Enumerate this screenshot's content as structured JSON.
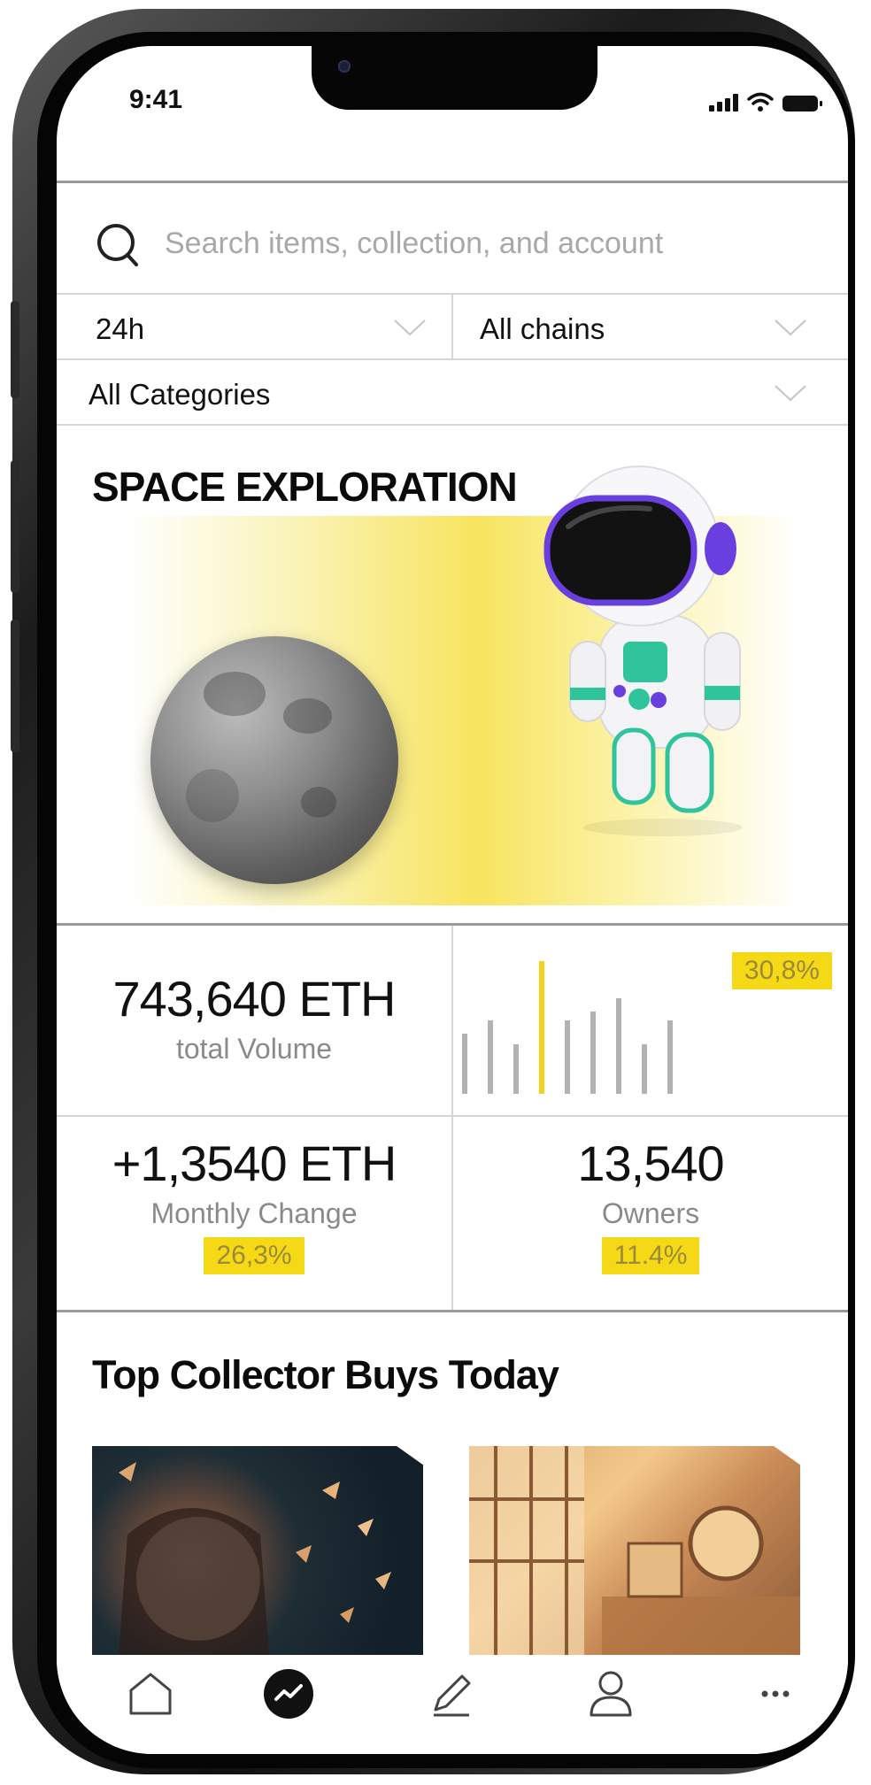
{
  "status_bar": {
    "time": "9:41"
  },
  "search": {
    "placeholder": "Search items, collection, and account"
  },
  "filters": {
    "time_range": "24h",
    "chain": "All chains",
    "category": "All Categories"
  },
  "hero": {
    "title": "SPACE EXPLORATION"
  },
  "stats": {
    "total_volume": {
      "value": "743,640 ETH",
      "label": "total Volume"
    },
    "volume_change": {
      "badge": "30,8%"
    },
    "monthly_change": {
      "value": "+1,3540 ETH",
      "label": "Monthly Change",
      "badge": "26,3%"
    },
    "owners": {
      "value": "13,540",
      "label": "Owners",
      "badge": "11.4%"
    },
    "bar_chart": {
      "values": [
        0.45,
        0.55,
        0.37,
        1.0,
        0.55,
        0.62,
        0.72,
        0.37,
        0.55
      ],
      "highlight_index": 3
    }
  },
  "collector": {
    "title": "Top Collector Buys Today",
    "cards": [
      {
        "image": "girl-petals-artwork"
      },
      {
        "image": "sunlit-room-artwork"
      }
    ]
  },
  "bottom_nav": {
    "items": [
      {
        "icon": "home-icon"
      },
      {
        "icon": "trending-icon",
        "active": true
      },
      {
        "icon": "pencil-icon"
      },
      {
        "icon": "user-icon"
      },
      {
        "icon": "more-icon"
      }
    ]
  },
  "colors": {
    "accent_yellow": "#f6d916",
    "astronaut_purple": "#6a3fe0",
    "astronaut_teal": "#2fc49c"
  }
}
